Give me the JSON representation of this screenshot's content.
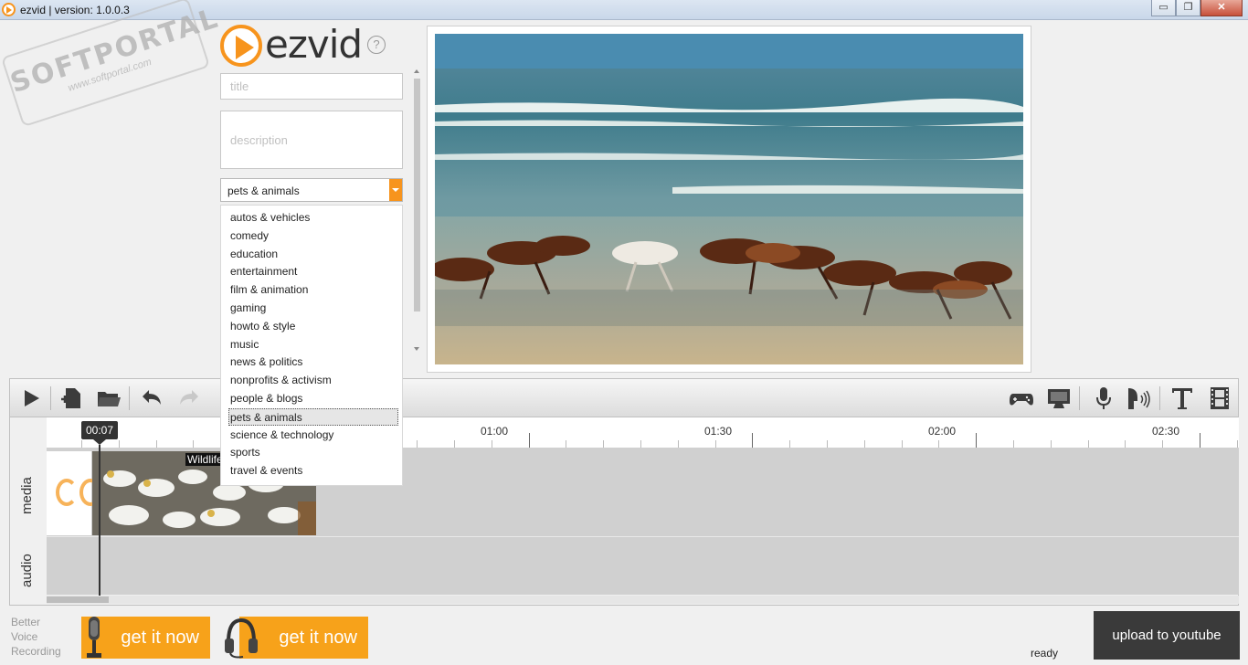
{
  "window": {
    "title": "ezvid | version: 1.0.0.3",
    "minimize": "▭",
    "restore": "❐",
    "close": "✕"
  },
  "watermark": {
    "main": "SOFTPORTAL",
    "sub": "www.softportal.com"
  },
  "logo": {
    "text": "ezvid",
    "help": "?"
  },
  "form": {
    "title_placeholder": "title",
    "description_placeholder": "description",
    "category_selected": "pets & animals",
    "category_options": [
      "autos & vehicles",
      "comedy",
      "education",
      "entertainment",
      "film & animation",
      "gaming",
      "howto & style",
      "music",
      "news & politics",
      "nonprofits & activism",
      "people & blogs",
      "pets & animals",
      "science & technology",
      "sports",
      "travel & events"
    ]
  },
  "toolbar": {
    "left_icons": [
      "play-icon",
      "new-project-icon",
      "open-folder-icon",
      "undo-icon",
      "redo-icon"
    ],
    "right_icons": [
      "game-controller-icon",
      "screen-capture-icon",
      "microphone-icon",
      "voice-synthesis-icon",
      "text-icon",
      "film-strip-icon"
    ]
  },
  "timeline": {
    "playhead": "00:07",
    "time_labels": [
      "01:00",
      "01:30",
      "02:00",
      "02:30"
    ],
    "tracks": {
      "media": "media",
      "audio": "audio"
    },
    "clip_label": "Wildlife"
  },
  "footer": {
    "promo_text": [
      "Better",
      "Voice",
      "Recording"
    ],
    "promo_button_1": "get it now",
    "promo_button_2": "get it now",
    "status": "ready",
    "upload": "upload to youtube"
  },
  "colors": {
    "accent": "#f7941d",
    "upload_bg": "#3a3a3a"
  }
}
